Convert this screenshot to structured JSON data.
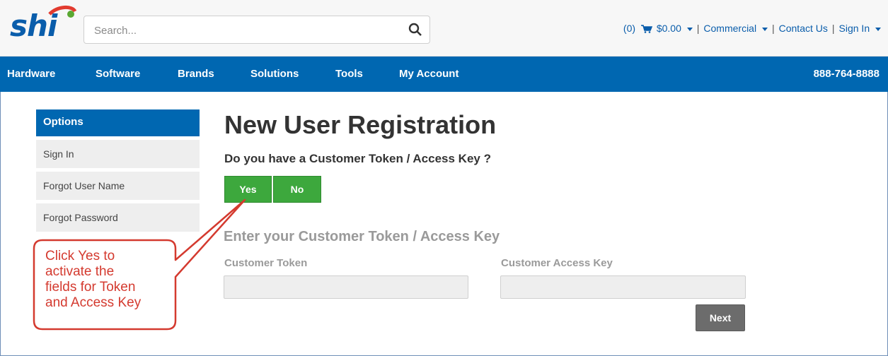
{
  "header": {
    "logo_text": "shi",
    "search_placeholder": "Search...",
    "cart_count": "(0)",
    "cart_total": "$0.00",
    "links": [
      "Commercial",
      "Contact Us",
      "Sign In"
    ]
  },
  "navbar": {
    "items": [
      "Hardware",
      "Software",
      "Brands",
      "Solutions",
      "Tools",
      "My Account"
    ],
    "phone": "888-764-8888"
  },
  "sidebar": {
    "heading": "Options",
    "items": [
      "Sign In",
      "Forgot User Name",
      "Forgot Password"
    ]
  },
  "main": {
    "title": "New User Registration",
    "question": "Do you have a Customer Token / Access Key ?",
    "yes_label": "Yes",
    "no_label": "No",
    "section_title": "Enter your Customer Token / Access Key",
    "token_label": "Customer Token",
    "access_key_label": "Customer Access Key",
    "next_label": "Next"
  },
  "callout": {
    "lines": [
      "Click Yes to",
      "activate the",
      "fields for Token",
      "and Access Key"
    ]
  },
  "colors": {
    "brand_blue": "#0067b1",
    "button_green": "#3da83d",
    "callout_red": "#d43a2f"
  }
}
